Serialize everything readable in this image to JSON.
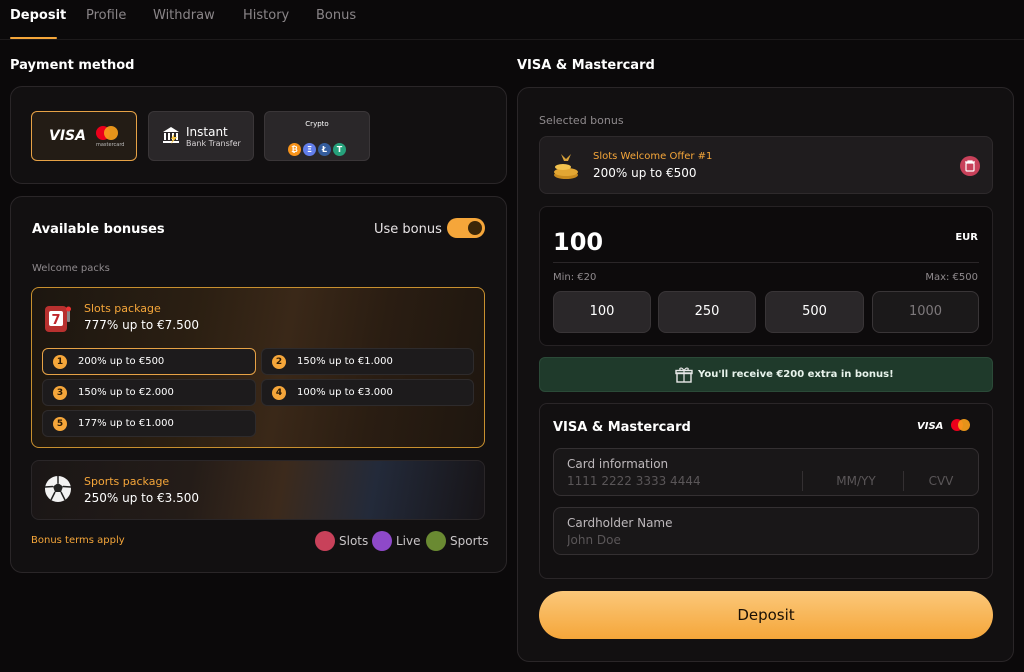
{
  "tabs": [
    {
      "label": "Deposit",
      "active": true
    },
    {
      "label": "Profile"
    },
    {
      "label": "Withdraw"
    },
    {
      "label": "History"
    },
    {
      "label": "Bonus"
    }
  ],
  "payment": {
    "heading": "Payment method",
    "methods": [
      {
        "label": "VISA",
        "sub": "mastercard",
        "icon": "mastercard-logo",
        "selected": true
      },
      {
        "label": "Instant",
        "sub": "Bank Transfer",
        "icon": "bank-icon"
      },
      {
        "label": "Crypto",
        "coins": [
          "₿",
          "Ξ",
          "Ł",
          "T"
        ],
        "coin_icons": [
          "bitcoin-icon",
          "ethereum-icon",
          "litecoin-icon",
          "tether-icon"
        ],
        "coin_colors": [
          "#f7931a",
          "#627eea",
          "#345d9d",
          "#26a17b"
        ]
      }
    ]
  },
  "bonuses": {
    "heading": "Available bonuses",
    "use_bonus_label": "Use bonus",
    "use_bonus_on": true,
    "section_label": "Welcome packs",
    "slots_pack": {
      "title": "Slots package",
      "offer": "777% up to €7.500",
      "icon": "slot-machine-icon"
    },
    "options": [
      {
        "num": "1",
        "text": "200% up to €500",
        "selected": true
      },
      {
        "num": "2",
        "text": "150% up to €1.000"
      },
      {
        "num": "3",
        "text": "150% up to €2.000"
      },
      {
        "num": "4",
        "text": "100% up to €3.000"
      },
      {
        "num": "5",
        "text": "177% up to €1.000"
      }
    ],
    "sports_pack": {
      "title": "Sports package",
      "offer": "250% up to €3.500",
      "icon": "soccer-ball-icon"
    },
    "terms": "Bonus terms apply",
    "filters": [
      {
        "label": "Slots",
        "color": "#c8415a",
        "icon": "slots-icon"
      },
      {
        "label": "Live",
        "color": "#8e49c9",
        "icon": "live-icon"
      },
      {
        "label": "Sports",
        "color": "#6a8a32",
        "icon": "sports-icon"
      }
    ]
  },
  "right": {
    "heading": "VISA & Mastercard",
    "selected_bonus_label": "Selected bonus",
    "selected_bonus": {
      "title": "Slots Welcome Offer #1",
      "offer": "200% up to €500",
      "icon": "coins-icon",
      "remove_icon": "trash-icon"
    },
    "amount": {
      "value": "100",
      "currency": "EUR",
      "min": "Min: €20",
      "max": "Max: €500"
    },
    "presets": [
      "100",
      "250",
      "500",
      "1000"
    ],
    "extra_bonus": "You'll receive €200 extra in bonus!",
    "card_section": {
      "title": "VISA & Mastercard",
      "visa": "VISA",
      "card_info_label": "Card information",
      "card_number_placeholder": "1111 2222 3333 4444",
      "expiry_placeholder": "MM/YY",
      "cvv_placeholder": "CVV",
      "holder_label": "Cardholder Name",
      "holder_placeholder": "John Doe"
    },
    "deposit_button": "Deposit"
  },
  "colors": {
    "accent": "#f5a63a",
    "success_bg": "#1f3a2b"
  }
}
